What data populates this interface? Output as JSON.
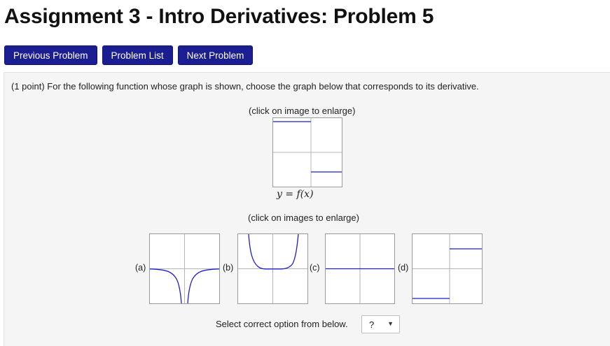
{
  "page": {
    "title": "Assignment 3 - Intro Derivatives: Problem 5"
  },
  "nav": {
    "previous": "Previous Problem",
    "list": "Problem List",
    "next": "Next Problem",
    "color": "#1b1e91"
  },
  "problem": {
    "statement": "(1 point) For the following function whose graph is shown, choose the graph below that corresponds to its derivative.",
    "enlarge_single": "(click on image to enlarge)",
    "function_label": "y = f(x)",
    "enlarge_multi": "(click on images to enlarge)",
    "options": [
      {
        "label": "(a)",
        "icon": "graph-thumbnail"
      },
      {
        "label": "(b)",
        "icon": "graph-thumbnail"
      },
      {
        "label": "(c)",
        "icon": "graph-thumbnail"
      },
      {
        "label": "(d)",
        "icon": "graph-thumbnail"
      }
    ],
    "select_prompt": "Select correct option from below.",
    "select_value": "?",
    "curve_color": "#1e1ec8"
  }
}
